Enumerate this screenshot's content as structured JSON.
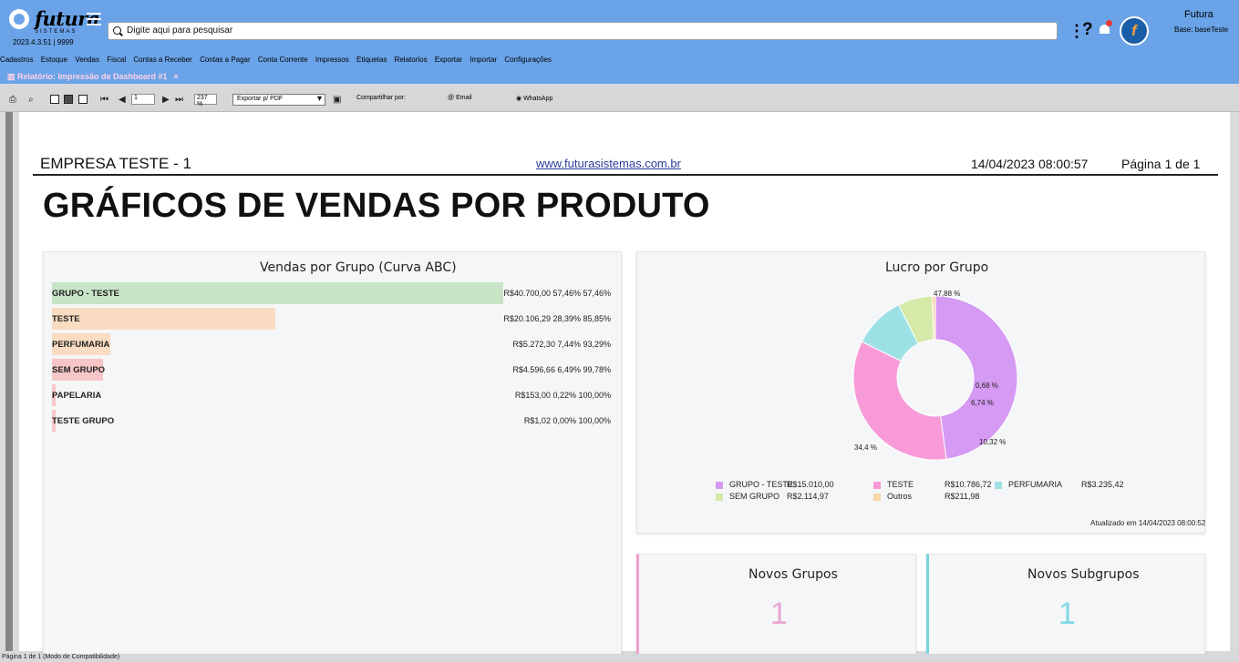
{
  "header": {
    "brand": "futura",
    "brand_sub": "SISTEMAS",
    "version": "2023.4.3.51 | 9999",
    "search_placeholder": "Digite aqui para pesquisar",
    "user": "Futura",
    "base": "Base: baseTeste",
    "menu": [
      "Cadastros",
      "Estoque",
      "Vendas",
      "Fiscal",
      "Contas a Receber",
      "Contas a Pagar",
      "Conta Corrente",
      "Impressos",
      "Etiquetas",
      "Relatorios",
      "Exportar",
      "Importar",
      "Configurações"
    ],
    "tab": "Relatório: Impressão de Dashboard #1",
    "tab_close": "×"
  },
  "toolbar": {
    "page_input": "1",
    "zoom": "237 %",
    "export_option": "Exportar p/ PDF",
    "share_label": "Compartilhar por:",
    "email": "Email",
    "whatsapp": "WhatsApp"
  },
  "report": {
    "company": "EMPRESA TESTE - 1",
    "site": "www.futurasistemas.com.br",
    "date": "14/04/2023 08:00:57",
    "page": "Página 1 de 1",
    "title": "GRÁFICOS DE VENDAS POR PRODUTO"
  },
  "abc_chart": {
    "title": "Vendas por Grupo (Curva ABC)",
    "rows": [
      {
        "label": "GRUPO - TESTE",
        "value": "R$40.700,00",
        "pct": "57,46%",
        "cum": "57,46%",
        "share": 57.46,
        "color": "#c7e4c7"
      },
      {
        "label": "TESTE",
        "value": "R$20.106,29",
        "pct": "28,39%",
        "cum": "85,85%",
        "share": 28.39,
        "color": "#f9dcc1"
      },
      {
        "label": "PERFUMARIA",
        "value": "R$5.272,30",
        "pct": "7,44%",
        "cum": "93,29%",
        "share": 7.44,
        "color": "#f9dcc1"
      },
      {
        "label": "SEM GRUPO",
        "value": "R$4.596,66",
        "pct": "6,49%",
        "cum": "99,78%",
        "share": 6.49,
        "color": "#f6c6c6"
      },
      {
        "label": "PAPELARIA",
        "value": "R$153,00",
        "pct": "0,22%",
        "cum": "100,00%",
        "share": 0.22,
        "color": "#f6c6c6"
      },
      {
        "label": "TESTE GRUPO",
        "value": "R$1,02",
        "pct": "0,00%",
        "cum": "100,00%",
        "share": 0.0,
        "color": "#f6c6c6"
      }
    ]
  },
  "profit_chart": {
    "title": "Lucro por Grupo",
    "slices": [
      {
        "name": "GRUPO - TESTE",
        "value": "R$15.010,00",
        "pct": "47,88 %",
        "percent": 47.88,
        "color": "#d59af3"
      },
      {
        "name": "TESTE",
        "value": "R$10.786,72",
        "pct": "34,4 %",
        "percent": 34.4,
        "color": "#f79ad7"
      },
      {
        "name": "PERFUMARIA",
        "value": "R$3.235,42",
        "pct": "10,32 %",
        "percent": 10.32,
        "color": "#9ee1e5"
      },
      {
        "name": "SEM GRUPO",
        "value": "R$2.114,97",
        "pct": "6,74 %",
        "percent": 6.74,
        "color": "#d5e9a9"
      },
      {
        "name": "Outros",
        "value": "R$211,98",
        "pct": "0,68 %",
        "percent": 0.68,
        "color": "#f7d8a8"
      }
    ],
    "updated": "Atualizado em 14/04/2023 08:00:52"
  },
  "kpis": {
    "groups_title": "Novos Grupos",
    "groups_value": "1",
    "subgroups_title": "Novos Subgrupos",
    "subgroups_value": "1",
    "groups_color": "#e8a8d3",
    "subgroups_color": "#80d8e6"
  },
  "status": "Página 1 de 1 (Modo de Compatibilidade)",
  "chart_data": [
    {
      "type": "bar",
      "title": "Vendas por Grupo (Curva ABC)",
      "categories": [
        "GRUPO - TESTE",
        "TESTE",
        "PERFUMARIA",
        "SEM GRUPO",
        "PAPELARIA",
        "TESTE GRUPO"
      ],
      "series": [
        {
          "name": "",
          "values": [
            57.46,
            28.39,
            7.44,
            6.49,
            0.22,
            0.0
          ]
        }
      ],
      "xlim": [
        0,
        100
      ],
      "grid": false
    },
    {
      "type": "pie",
      "title": "Lucro por Grupo",
      "categories": [
        "GRUPO - TESTE",
        "TESTE",
        "PERFUMARIA",
        "SEM GRUPO",
        "Outros"
      ],
      "values": [
        47.88,
        34.4,
        10.32,
        6.74,
        0.68
      ],
      "legend": "bottom"
    }
  ]
}
